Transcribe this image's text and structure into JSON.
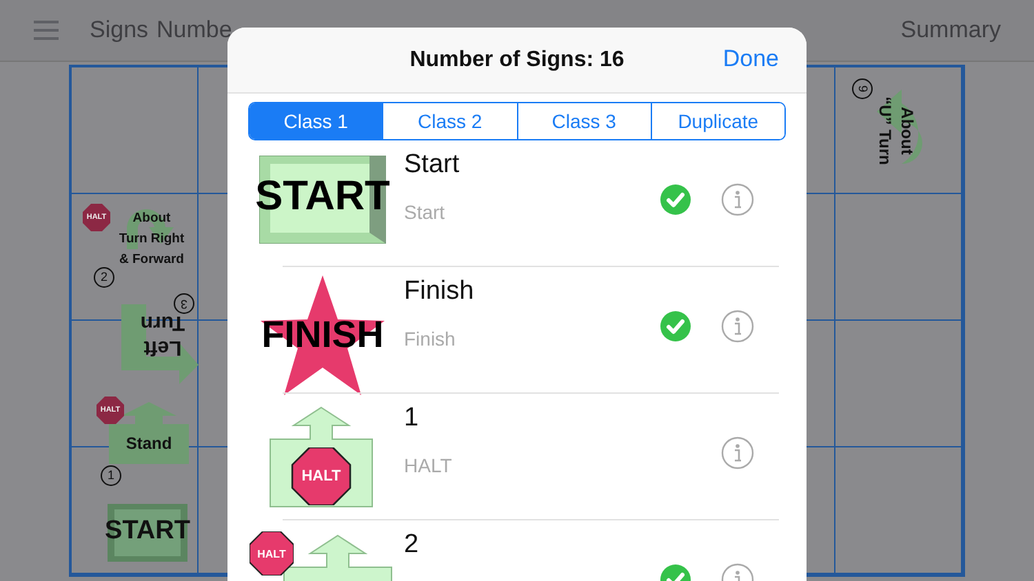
{
  "nav": {
    "items": [
      "Signs",
      "Numbe"
    ],
    "summary": "Summary"
  },
  "course_signs": [
    {
      "kind": "about_turn_right",
      "lines": [
        "About",
        "Turn Right",
        "& Forward"
      ],
      "halt": "HALT",
      "number": "2"
    },
    {
      "kind": "left_turn",
      "lines": [
        "Left",
        "Turn"
      ],
      "number": "3"
    },
    {
      "kind": "stand",
      "lines": [
        "Stand"
      ],
      "halt": "HALT",
      "number": "1"
    },
    {
      "kind": "start",
      "lines": [
        "START"
      ]
    },
    {
      "kind": "about_u_turn",
      "lines": [
        "About",
        "“U” Turn"
      ],
      "number": "9"
    }
  ],
  "dialog": {
    "title": "Number of Signs: 16",
    "done": "Done",
    "tabs": [
      {
        "label": "Class 1",
        "selected": true
      },
      {
        "label": "Class 2",
        "selected": false
      },
      {
        "label": "Class 3",
        "selected": false
      },
      {
        "label": "Duplicate",
        "selected": false
      }
    ],
    "signs": [
      {
        "kind": "start",
        "art_text": "START",
        "name": "Start",
        "subtitle": "Start",
        "checked": true
      },
      {
        "kind": "finish",
        "art_text": "FINISH",
        "name": "Finish",
        "subtitle": "Finish",
        "checked": true
      },
      {
        "kind": "halt_forward",
        "art_text": "HALT",
        "name": "1",
        "subtitle": "HALT",
        "checked": false
      },
      {
        "kind": "halt_corner",
        "art_text": "HALT",
        "name": "2",
        "checked": true
      }
    ]
  }
}
